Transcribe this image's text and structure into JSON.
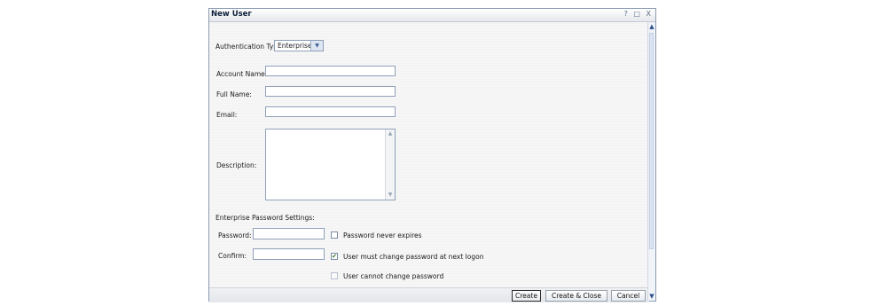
{
  "dialog": {
    "title": "New User",
    "titlebar_icons": "? □ X"
  },
  "form": {
    "auth_type_label": "Authentication Type:",
    "auth_type_value": "Enterprise",
    "account_name_label": "Account Name:",
    "full_name_label": "Full Name:",
    "email_label": "Email:",
    "description_label": "Description:",
    "password_section_label": "Enterprise Password Settings:",
    "password_label": "Password:",
    "confirm_label": "Confirm:",
    "checkboxes": [
      {
        "label": "Password never expires",
        "checked": false
      },
      {
        "label": "User must change password at next logon",
        "checked": true
      },
      {
        "label": "User cannot change password",
        "checked": false
      }
    ]
  },
  "footer": {
    "create": "Create",
    "create_close": "Create & Close",
    "cancel": "Cancel"
  },
  "icons": {
    "dropdown": "chevron-down-icon",
    "scroll_up": "arrow-up-icon",
    "scroll_down": "arrow-down-icon",
    "checkmark": "checkmark-icon"
  }
}
